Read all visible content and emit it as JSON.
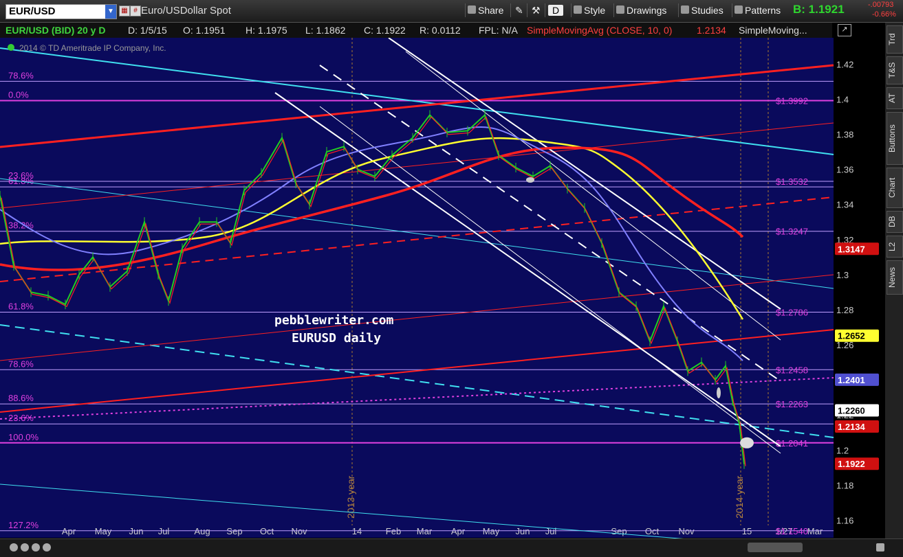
{
  "toolbar": {
    "symbol": "EUR/USD",
    "description": "Euro/USDollar Spot",
    "share": "Share",
    "style": "Style",
    "drawings": "Drawings",
    "studies": "Studies",
    "patterns": "Patterns",
    "d_label": "D",
    "bid": "B: 1.1921",
    "change_abs": "-.00793",
    "change_pct": "-0.66%"
  },
  "infobar": {
    "instrument": "EUR/USD (BID) 20 y D",
    "date": "D: 1/5/15",
    "open": "O: 1.1951",
    "high": "H: 1.1975",
    "low": "L: 1.1862",
    "close": "C: 1.1922",
    "range": "R: 0.0112",
    "fpl": "FPL: N/A",
    "sma_label": "SimpleMovingAvg (CLOSE, 10, 0)",
    "sma_value": "1.2134",
    "sma2_label": "SimpleMoving..."
  },
  "copyright": "2014 © TD Ameritrade IP Company, Inc.",
  "watermark": {
    "line1": "pebblewriter.com",
    "line2": "EURUSD daily"
  },
  "right_tabs": [
    "Trd",
    "T&S",
    "AT",
    "Buttons",
    "Chart",
    "DB",
    "L2",
    "News"
  ],
  "colors": {
    "bg": "#0a0a5c",
    "fib": "#e040e0",
    "red": "#ff2020",
    "cyan": "#40e0f0",
    "yellow": "#ffff30",
    "blue": "#8080ff",
    "white": "#ffffff",
    "green": "#22cc22"
  },
  "chart_data": {
    "type": "line",
    "title": "EURUSD daily",
    "ylim": [
      1.15,
      1.435
    ],
    "y_ticks": [
      1.42,
      1.4,
      1.38,
      1.36,
      1.34,
      1.32,
      1.3,
      1.28,
      1.26,
      1.24,
      1.22,
      1.2,
      1.18,
      1.16
    ],
    "x_labels": [
      "Apr",
      "May",
      "Jun",
      "Jul",
      "Aug",
      "Sep",
      "Oct",
      "Nov",
      "14",
      "Feb",
      "Mar",
      "Apr",
      "May",
      "Jun",
      "Jul",
      "Sep",
      "Oct",
      "Nov",
      "15",
      "1/27",
      "Mar"
    ],
    "year_labels": [
      "2013 year",
      "2014 year"
    ],
    "fib_lines": [
      {
        "label": "78.6%",
        "value": 1.4102,
        "right": ""
      },
      {
        "label": "0.0%",
        "value": 1.3992,
        "right": "$1.3992"
      },
      {
        "label": "23.6%",
        "value": 1.3532,
        "right": "$1.3532"
      },
      {
        "label": "61.8%",
        "value": 1.35,
        "right": ""
      },
      {
        "label": "38.2%",
        "value": 1.3247,
        "right": "$1.3247"
      },
      {
        "label": "61.8%",
        "value": 1.2786,
        "right": "$1.2786"
      },
      {
        "label": "78.6%",
        "value": 1.2458,
        "right": "$1.2458"
      },
      {
        "label": "88.6%",
        "value": 1.2263,
        "right": "$1.2263"
      },
      {
        "label": "23.6%",
        "value": 1.2149,
        "right": ""
      },
      {
        "label": "100.0%",
        "value": 1.2041,
        "right": "$1.2041"
      },
      {
        "label": "127.2%",
        "value": 1.154,
        "right": "$1.1540"
      }
    ],
    "price_tags": [
      {
        "value": "1.3147",
        "y": 1.3147,
        "bg": "#d01010",
        "fg": "#fff"
      },
      {
        "value": "1.2652",
        "y": 1.2652,
        "bg": "#ffff30",
        "fg": "#000"
      },
      {
        "value": "1.2401",
        "y": 1.2401,
        "bg": "#5050d0",
        "fg": "#fff"
      },
      {
        "value": "1.2260",
        "y": 1.2226,
        "bg": "#ffffff",
        "fg": "#000"
      },
      {
        "value": "1.2134",
        "y": 1.2134,
        "bg": "#d01010",
        "fg": "#fff"
      },
      {
        "value": "1.1922",
        "y": 1.1922,
        "bg": "#d01010",
        "fg": "#fff"
      }
    ],
    "price_series": [
      {
        "x": 0,
        "y": 1.345
      },
      {
        "x": 20,
        "y": 1.305
      },
      {
        "x": 45,
        "y": 1.29
      },
      {
        "x": 70,
        "y": 1.288
      },
      {
        "x": 95,
        "y": 1.283
      },
      {
        "x": 115,
        "y": 1.3
      },
      {
        "x": 135,
        "y": 1.31
      },
      {
        "x": 160,
        "y": 1.293
      },
      {
        "x": 185,
        "y": 1.302
      },
      {
        "x": 210,
        "y": 1.33
      },
      {
        "x": 230,
        "y": 1.3
      },
      {
        "x": 245,
        "y": 1.285
      },
      {
        "x": 265,
        "y": 1.315
      },
      {
        "x": 290,
        "y": 1.33
      },
      {
        "x": 315,
        "y": 1.33
      },
      {
        "x": 335,
        "y": 1.318
      },
      {
        "x": 355,
        "y": 1.348
      },
      {
        "x": 380,
        "y": 1.358
      },
      {
        "x": 410,
        "y": 1.378
      },
      {
        "x": 430,
        "y": 1.352
      },
      {
        "x": 450,
        "y": 1.34
      },
      {
        "x": 475,
        "y": 1.37
      },
      {
        "x": 500,
        "y": 1.373
      },
      {
        "x": 520,
        "y": 1.36
      },
      {
        "x": 545,
        "y": 1.356
      },
      {
        "x": 570,
        "y": 1.368
      },
      {
        "x": 600,
        "y": 1.378
      },
      {
        "x": 625,
        "y": 1.391
      },
      {
        "x": 650,
        "y": 1.381
      },
      {
        "x": 680,
        "y": 1.382
      },
      {
        "x": 705,
        "y": 1.391
      },
      {
        "x": 725,
        "y": 1.368
      },
      {
        "x": 750,
        "y": 1.361
      },
      {
        "x": 775,
        "y": 1.356
      },
      {
        "x": 800,
        "y": 1.362
      },
      {
        "x": 825,
        "y": 1.349
      },
      {
        "x": 850,
        "y": 1.338
      },
      {
        "x": 875,
        "y": 1.318
      },
      {
        "x": 900,
        "y": 1.29
      },
      {
        "x": 925,
        "y": 1.282
      },
      {
        "x": 945,
        "y": 1.262
      },
      {
        "x": 965,
        "y": 1.282
      },
      {
        "x": 985,
        "y": 1.262
      },
      {
        "x": 1000,
        "y": 1.245
      },
      {
        "x": 1020,
        "y": 1.25
      },
      {
        "x": 1040,
        "y": 1.24
      },
      {
        "x": 1055,
        "y": 1.248
      },
      {
        "x": 1065,
        "y": 1.228
      },
      {
        "x": 1075,
        "y": 1.215
      },
      {
        "x": 1082,
        "y": 1.192
      }
    ]
  }
}
